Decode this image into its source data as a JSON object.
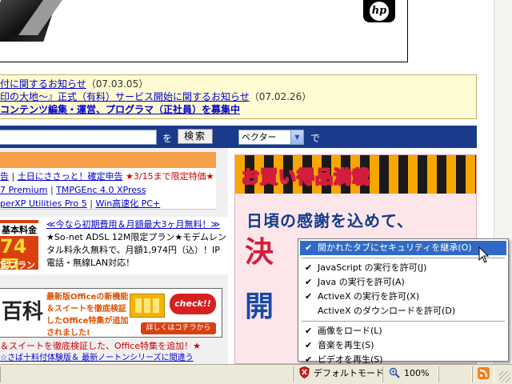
{
  "banner": {
    "brand": "hp"
  },
  "news": [
    {
      "text": "付に関するお知らせ",
      "date": "（07.03.05）"
    },
    {
      "text": "印の大地〜』正式（有料）サービス開始に関するお知らせ",
      "date": "（07.02.26）"
    },
    {
      "text": "コンテンツ編集・運営、プログラマ（正社員）を募集中",
      "date": ""
    }
  ],
  "search": {
    "wo": "を",
    "button_label": "検索",
    "selected_option": "ベクター",
    "de": "で"
  },
  "left_links": {
    "row1_a": "告",
    "row1_sep": "|",
    "row1_b": "土日にささっと！確定申告",
    "row1_c": "★3/15まで限定特価★",
    "row2_a": "7 Premium",
    "row2_b": "TMPGEnc 4.0 XPress",
    "row3_a": "perXP Utilities Pro 5",
    "row3_b": "Win高速化 PC+"
  },
  "promo": {
    "badge_top": "基本料金",
    "badge_price": "74円",
    "badge_bottom": "定プラン",
    "headline": "≪今なら初期費用＆月額最大3ヶ月無料！≫",
    "body": "★So-net ADSL 12M限定プラン★モデムレンタル料永久無料で、月額1,974円（込）！IP電話・無線LAN対応！"
  },
  "office_ad": {
    "hyakka": "百科",
    "text": "最新版Officeの新機能＆スイートを徹底検証したOffice特集が追加されました!",
    "check": "check!!",
    "detail": "詳しくはコチラから"
  },
  "office_line": "＆スイートを徹底検証した、Office特集を追加！★",
  "bottom_line": "☆さば十料付体験版＆ 最新ノートンシリーズに間違う",
  "right_ad": {
    "title": "お買い得品満載",
    "line1": "日頃の感謝を込めて、",
    "line2": "決",
    "line3": "開"
  },
  "context_menu": {
    "items": [
      {
        "label": "開かれたタブにセキュリティを継承(O)",
        "checked": "✔",
        "highlighted": true
      },
      {
        "label": "JavaScript の実行を許可(J)",
        "checked": "✔"
      },
      {
        "label": "Java の実行を許可(A)",
        "checked": "✔"
      },
      {
        "label": "ActiveX の実行を許可(X)",
        "checked": "✔"
      },
      {
        "label": "ActiveX のダウンロードを許可(D)",
        "checked": ""
      },
      {
        "label": "画像をロード(L)",
        "checked": "✔"
      },
      {
        "label": "音楽を再生(S)",
        "checked": "✔"
      },
      {
        "label": "ビデオを再生(S)",
        "checked": "✔"
      }
    ]
  },
  "statusbar": {
    "security_mode": "デフォルトモード",
    "zoom": "100%"
  },
  "colors": {
    "search_bar": "#1a3a8c",
    "menu_highlight": "#316ac5",
    "news_bg": "#fffbd2",
    "link": "#0000cc"
  }
}
